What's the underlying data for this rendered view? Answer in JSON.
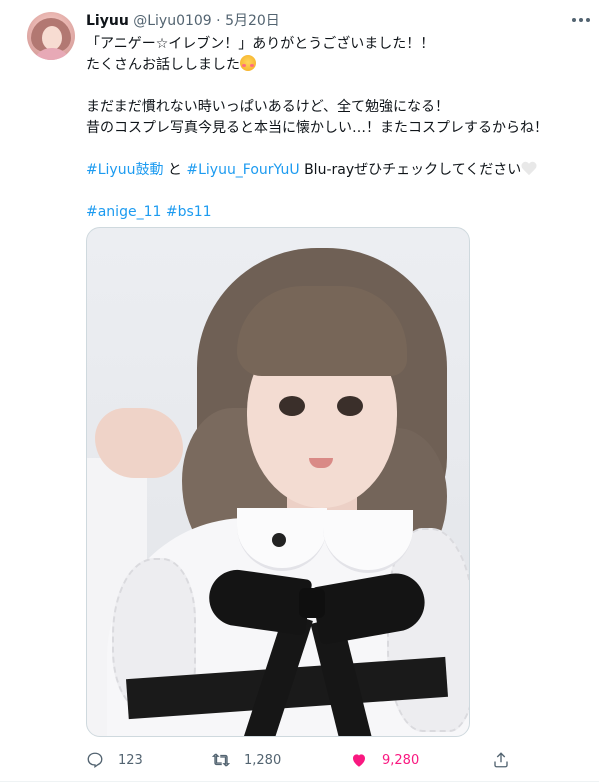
{
  "tweet": {
    "author_name": "Liyuu",
    "handle": "@Liyu0109",
    "separator": "·",
    "date": "5月20日",
    "lines": {
      "l1": "「アニゲー☆イレブン！」ありがとうございました！！",
      "l2": "たくさんお話ししました",
      "l3": "まだまだ慣れない時いっぱいあるけど、全て勉強になる！",
      "l4": "昔のコスプレ写真今見ると本当に懐かしい…！またコスプレするからね！",
      "hashtag1": "#Liyuu鼓動",
      "and": " と ",
      "hashtag2": "#Liyuu_FourYuU",
      "l5_rest": " Blu-rayぜひチェックしてください",
      "hashtag3": "#anige_11",
      "hashtag4": "#bs11"
    },
    "stats": {
      "replies": "123",
      "retweets": "1,280",
      "likes": "9,280"
    }
  },
  "colors": {
    "link": "#1d9bf0",
    "like": "#f91880",
    "secondary": "#536471"
  },
  "icons": [
    "more-icon",
    "reply-icon",
    "retweet-icon",
    "like-icon",
    "share-icon",
    "smiling-hearts-emoji",
    "white-heart-emoji"
  ]
}
